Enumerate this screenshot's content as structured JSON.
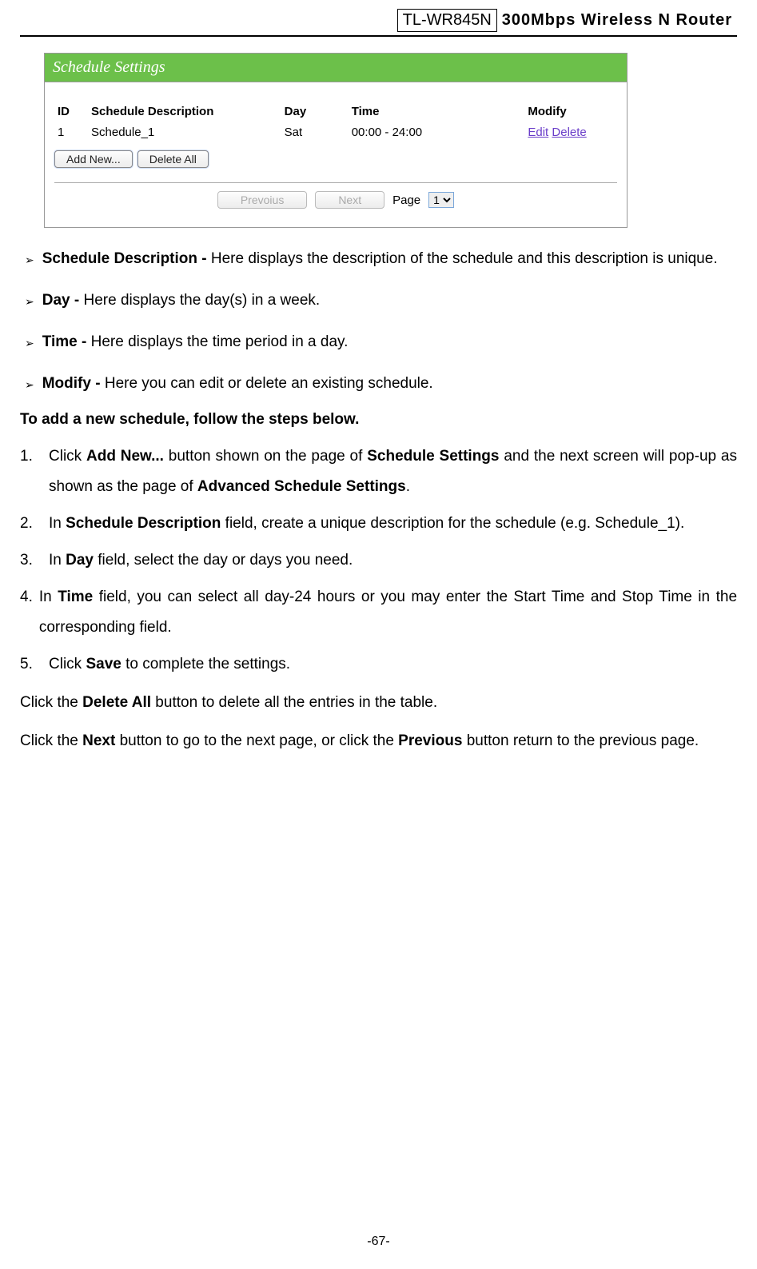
{
  "header": {
    "model": "TL-WR845N",
    "product": "300Mbps Wireless N Router"
  },
  "screenshot": {
    "title": "Schedule Settings",
    "columns": {
      "id": "ID",
      "desc": "Schedule Description",
      "day": "Day",
      "time": "Time",
      "modify": "Modify"
    },
    "row": {
      "id": "1",
      "desc": "Schedule_1",
      "day": "Sat",
      "time": "00:00 - 24:00",
      "edit": "Edit",
      "delete": "Delete"
    },
    "buttons": {
      "add": "Add New...",
      "delall": "Delete All"
    },
    "pager": {
      "prev": "Prevoius",
      "next": "Next",
      "page_label": "Page",
      "page_value": "1"
    }
  },
  "bullets": {
    "b1_label": "Schedule Description - ",
    "b1_text": "Here displays the description of the schedule and this description is unique.",
    "b2_label": "Day - ",
    "b2_text": "Here displays the day(s) in a week.",
    "b3_label": "Time - ",
    "b3_text": "Here displays the time period in a day.",
    "b4_label": "Modify - ",
    "b4_text": "Here you can edit or delete an existing schedule."
  },
  "heading": "To add a new schedule, follow the steps below.",
  "steps": {
    "s1_num": "1.",
    "s1_a": "Click ",
    "s1_b": "Add New...",
    "s1_c": " button shown on the page of ",
    "s1_d": "Schedule Settings",
    "s1_e": " and the next screen will pop-up as shown as the page of ",
    "s1_f": "Advanced Schedule Settings",
    "s1_g": ".",
    "s2_num": "2.",
    "s2_a": "In ",
    "s2_b": "Schedule Description",
    "s2_c": " field, create a unique description for the schedule (e.g. Schedule_1).",
    "s3_num": "3.",
    "s3_a": "In ",
    "s3_b": "Day",
    "s3_c": " field, select the day or days you need.",
    "s4_num": "4.",
    "s4_a": "In ",
    "s4_b": "Time",
    "s4_c": " field, you can select all day-24 hours or you may enter the Start Time and Stop Time in the corresponding field.",
    "s5_num": "5.",
    "s5_a": "Click ",
    "s5_b": "Save",
    "s5_c": " to complete the settings."
  },
  "p1_a": "Click the ",
  "p1_b": "Delete All",
  "p1_c": " button to delete all the entries in the table.",
  "p2_a": "Click the ",
  "p2_b": "Next",
  "p2_c": " button to go to the next page, or click the ",
  "p2_d": "Previous",
  "p2_e": " button return to the previous page.",
  "page_number": "-67-"
}
